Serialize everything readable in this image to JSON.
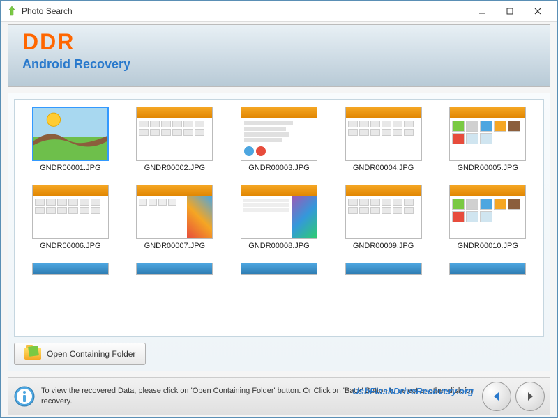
{
  "window": {
    "title": "Photo Search"
  },
  "header": {
    "logo": "DDR",
    "subtitle": "Android Recovery"
  },
  "thumbnails": [
    {
      "label": "GNDR00001.JPG",
      "selected": true,
      "kind": "photo"
    },
    {
      "label": "GNDR00002.JPG",
      "selected": false,
      "kind": "grid"
    },
    {
      "label": "GNDR00003.JPG",
      "selected": false,
      "kind": "form"
    },
    {
      "label": "GNDR00004.JPG",
      "selected": false,
      "kind": "grid"
    },
    {
      "label": "GNDR00005.JPG",
      "selected": false,
      "kind": "icons"
    },
    {
      "label": "GNDR00006.JPG",
      "selected": false,
      "kind": "grid"
    },
    {
      "label": "GNDR00007.JPG",
      "selected": false,
      "kind": "panel"
    },
    {
      "label": "GNDR00008.JPG",
      "selected": false,
      "kind": "panel2"
    },
    {
      "label": "GNDR00009.JPG",
      "selected": false,
      "kind": "grid"
    },
    {
      "label": "GNDR00010.JPG",
      "selected": false,
      "kind": "icons"
    }
  ],
  "buttons": {
    "open_folder": "Open Containing Folder"
  },
  "footer": {
    "hint": "To view the recovered Data, please click on 'Open Containing Folder' button. Or Click on 'Back' Button to select another disk for recovery.",
    "watermark": "UsbFlashDriveRecovery.org"
  }
}
